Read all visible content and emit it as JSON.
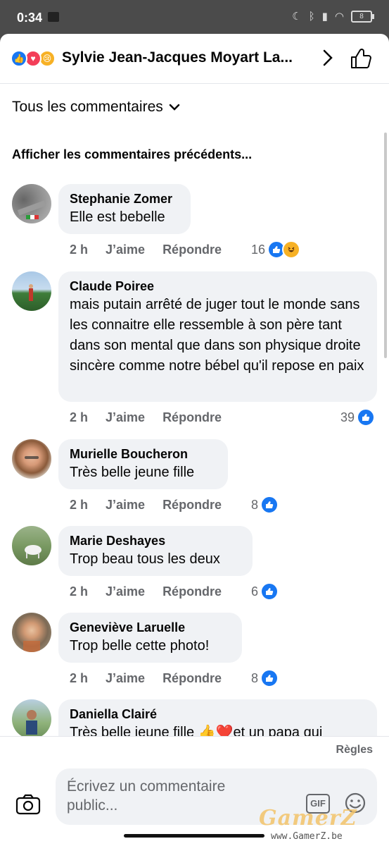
{
  "status": {
    "time": "0:34",
    "battery": "8"
  },
  "header": {
    "title": "Sylvie Jean-Jacques Moyart La..."
  },
  "filter": {
    "label": "Tous les commentaires"
  },
  "previous": {
    "label": "Afficher les commentaires précédents..."
  },
  "comments": [
    {
      "name": "Stephanie Zomer",
      "text": "Elle est bebelle",
      "time": "2 h",
      "like": "J’aime",
      "reply": "Répondre",
      "reactions": "16",
      "reaction_types": [
        "like",
        "haha"
      ]
    },
    {
      "name": "Claude Poiree",
      "text": "mais putain arrêté de  juger tout le monde sans les connaitre elle ressemble à son père tant dans son mental que dans son physique  droite sincère comme notre bébel qu'il repose en paix",
      "time": "2 h",
      "like": "J’aime",
      "reply": "Répondre",
      "reactions": "39",
      "reaction_types": [
        "like"
      ]
    },
    {
      "name": "Murielle Boucheron",
      "text": "Très belle jeune fille",
      "time": "2 h",
      "like": "J’aime",
      "reply": "Répondre",
      "reactions": "8",
      "reaction_types": [
        "like"
      ]
    },
    {
      "name": "Marie Deshayes",
      "text": "Trop beau tous les deux",
      "time": "2 h",
      "like": "J’aime",
      "reply": "Répondre",
      "reactions": "6",
      "reaction_types": [
        "like"
      ]
    },
    {
      "name": "Geneviève Laruelle",
      "text": "Trop belle cette photo!",
      "time": "2 h",
      "like": "J’aime",
      "reply": "Répondre",
      "reactions": "8",
      "reaction_types": [
        "like"
      ]
    },
    {
      "name": "Daniella Clairé",
      "text": "Très belle jeune fille 👍❤️et un papa qui",
      "time": "",
      "like": "",
      "reply": "",
      "reactions": "",
      "reaction_types": []
    }
  ],
  "footer": {
    "rules": "Règles",
    "input_placeholder": "Écrivez un commentaire public...",
    "gif": "GIF"
  },
  "watermark": {
    "brand": "GamerZ",
    "url": "www.GamerZ.be"
  },
  "colors": {
    "accent": "#1877f2",
    "bubble": "#f0f2f5",
    "meta": "#65676b",
    "love": "#f33e58",
    "haha": "#f7b125"
  }
}
